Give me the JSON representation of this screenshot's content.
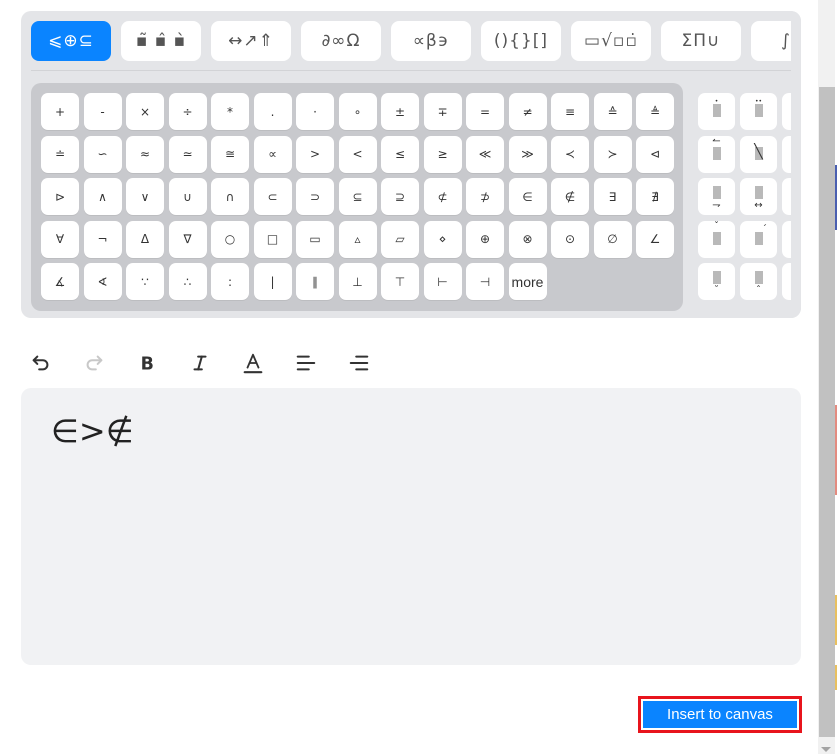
{
  "categories": [
    {
      "label": "⩽⊕⊆",
      "active": true,
      "name": "relations-operators"
    },
    {
      "label": "▪̃ ▪̂ ▪̀",
      "active": false,
      "name": "accents"
    },
    {
      "label": "↔↗⇑",
      "active": false,
      "name": "arrows"
    },
    {
      "label": "∂∞Ω",
      "active": false,
      "name": "misc-symbols"
    },
    {
      "label": "∝β϶",
      "active": false,
      "name": "greek"
    },
    {
      "label": "(){}[]",
      "active": false,
      "name": "brackets"
    },
    {
      "label": "▭√▫▫̇",
      "active": false,
      "name": "fractions-roots"
    },
    {
      "label": "ΣΠ∪",
      "active": false,
      "name": "large-operators"
    },
    {
      "label": "∫∮",
      "active": false,
      "name": "integrals"
    }
  ],
  "symbols": [
    "+",
    "-",
    "×",
    "÷",
    "*",
    ".",
    "·",
    "∘",
    "±",
    "∓",
    "=",
    "≠",
    "≡",
    "≙",
    "≜",
    "≐",
    "∽",
    "≈",
    "≃",
    "≅",
    "∝",
    ">",
    "<",
    "≤",
    "≥",
    "≪",
    "≫",
    "≺",
    "≻",
    "⊲",
    "⊳",
    "∧",
    "∨",
    "∪",
    "∩",
    "⊂",
    "⊃",
    "⊆",
    "⊇",
    "⊄",
    "⊅",
    "∈",
    "∉",
    "∃",
    "∄",
    "∀",
    "¬",
    "Δ",
    "∇",
    "○",
    "□",
    "▭",
    "▵",
    "▱",
    "⋄",
    "⊕",
    "⊗",
    "⊙",
    "∅",
    "∠",
    "∡",
    "∢",
    "∵",
    "∴",
    ":",
    "|",
    "∥",
    "⊥",
    "⊤",
    "⊢",
    "⊣"
  ],
  "more_label": "more",
  "accents": [
    {
      "name": "dot-accent",
      "mark": "•",
      "pos": "top"
    },
    {
      "name": "double-dot-accent",
      "mark": "••",
      "pos": "top"
    },
    {
      "name": "partial-accent-1",
      "mark": "",
      "pos": "top"
    },
    {
      "name": "left-harpoon-accent",
      "mark": "↼",
      "pos": "top"
    },
    {
      "name": "strikethrough-accent",
      "mark": "╲",
      "pos": "over"
    },
    {
      "name": "partial-accent-2",
      "mark": "",
      "pos": "top"
    },
    {
      "name": "under-right-arrow-accent",
      "mark": "⇁",
      "pos": "bottom"
    },
    {
      "name": "under-double-arrow-accent",
      "mark": "↔",
      "pos": "bottom"
    },
    {
      "name": "partial-accent-3",
      "mark": "",
      "pos": "top"
    },
    {
      "name": "check-accent",
      "mark": "ˇ",
      "pos": "top"
    },
    {
      "name": "acute-accent",
      "mark": "ˊ",
      "pos": "topright"
    },
    {
      "name": "partial-accent-4",
      "mark": "",
      "pos": "top"
    },
    {
      "name": "under-breve-accent",
      "mark": "˘",
      "pos": "bottom"
    },
    {
      "name": "under-hat-accent",
      "mark": "ˆ",
      "pos": "bottom"
    },
    {
      "name": "partial-accent-5",
      "mark": "",
      "pos": "top"
    }
  ],
  "toolbar": {
    "undo": "undo",
    "redo": "redo",
    "bold": "B",
    "italic": "I",
    "font_color": "A",
    "align_left": "align-left",
    "align_center": "align-center"
  },
  "editor": {
    "content": "∈>∉"
  },
  "insert_button": {
    "label": "Insert to canvas"
  },
  "colors": {
    "accent": "#0a84ff",
    "highlight_border": "#e8141c"
  }
}
